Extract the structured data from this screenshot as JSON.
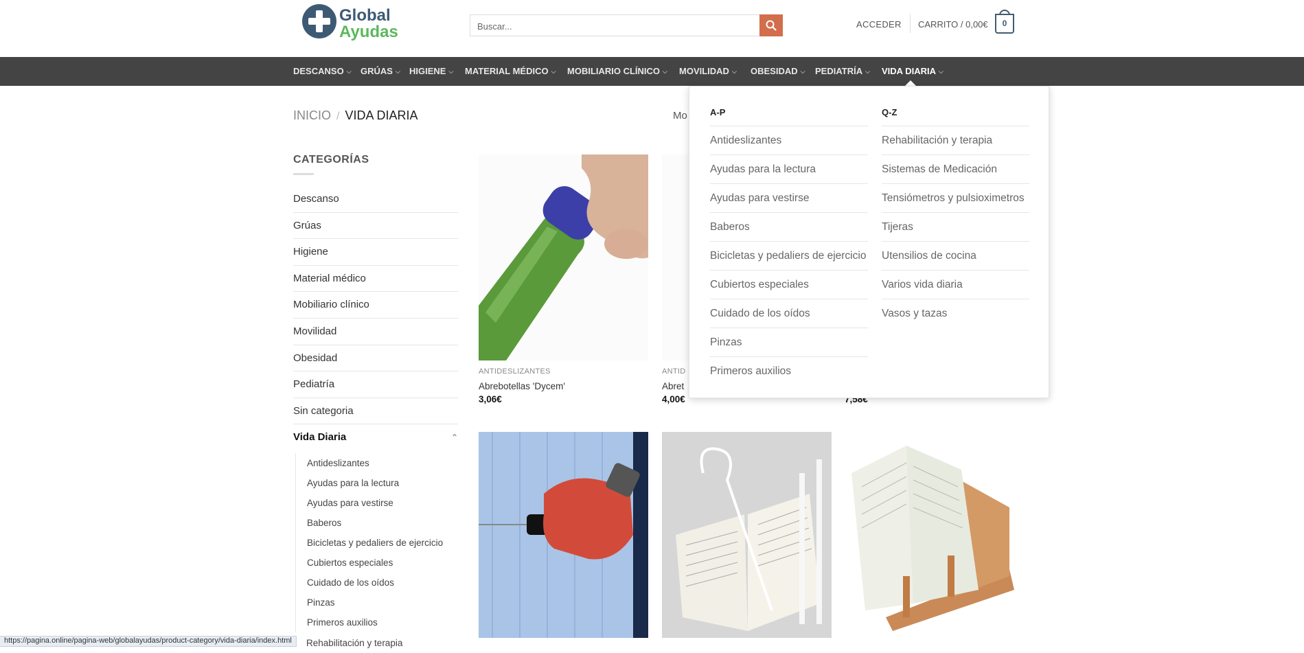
{
  "brand": {
    "line1": "Global",
    "line2": "Ayudas"
  },
  "search": {
    "placeholder": "Buscar..."
  },
  "header": {
    "login": "ACCEDER",
    "cart_label": "CARRITO / 0,00€",
    "cart_count": "0"
  },
  "nav": [
    {
      "label": "DESCANSO"
    },
    {
      "label": "GRÚAS"
    },
    {
      "label": "HIGIENE"
    },
    {
      "label": "MATERIAL MÉDICO"
    },
    {
      "label": "MOBILIARIO CLÍNICO"
    },
    {
      "label": "MOVILIDAD"
    },
    {
      "label": "OBESIDAD"
    },
    {
      "label": "PEDIATRÍA"
    },
    {
      "label": "VIDA DIARIA"
    }
  ],
  "breadcrumb": {
    "home": "INICIO",
    "sep": "/",
    "current": "VIDA DIARIA"
  },
  "sort_partial": "Mo",
  "sidebar": {
    "title": "CATEGORÍAS",
    "categories": [
      "Descanso",
      "Grúas",
      "Higiene",
      "Material médico",
      "Mobiliario clínico",
      "Movilidad",
      "Obesidad",
      "Pediatría",
      "Sin categoria",
      "Vida Diaria"
    ],
    "subcategories": [
      "Antideslizantes",
      "Ayudas para la lectura",
      "Ayudas para vestirse",
      "Baberos",
      "Bicicletas y pedaliers de ejercicio",
      "Cubiertos especiales",
      "Cuidado de los oídos",
      "Pinzas",
      "Primeros auxilios"
    ],
    "cut_item": "Rehabilitación y terapia"
  },
  "products": [
    {
      "category": "ANTIDESLIZANTES",
      "name": "Abrebotellas 'Dycem'",
      "price": "3,06€"
    },
    {
      "category": "ANTID",
      "name": "Abret",
      "price": "4,00€"
    },
    {
      "category": "",
      "name": "",
      "price": "7,58€"
    }
  ],
  "mega_menu": {
    "col1": {
      "title": "A-P",
      "items": [
        "Antideslizantes",
        "Ayudas para la lectura",
        "Ayudas para vestirse",
        "Baberos",
        "Bicicletas y pedaliers de ejercicio",
        "Cubiertos especiales",
        "Cuidado de los oídos",
        "Pinzas",
        "Primeros auxilios"
      ]
    },
    "col2": {
      "title": "Q-Z",
      "items": [
        "Rehabilitación y terapia",
        "Sistemas de Medicación",
        "Tensiómetros y pulsioximetros",
        "Tijeras",
        "Utensilios de cocina",
        "Varios vida diaria",
        "Vasos y tazas"
      ]
    }
  },
  "status_url": "https://pagina.online/pagina-web/globalayudas/product-category/vida-diaria/index.html",
  "colors": {
    "nav_bg": "#444444",
    "accent": "#d26e4b",
    "brand_blue": "#3d5a75",
    "brand_green": "#5cb85c"
  }
}
